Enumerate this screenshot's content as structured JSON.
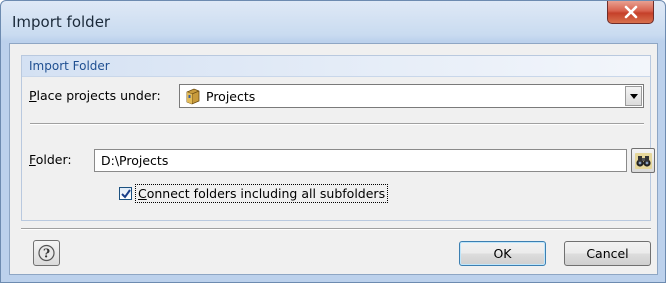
{
  "window": {
    "title": "Import folder"
  },
  "group": {
    "title": "Import Folder"
  },
  "place": {
    "label_prefix": "",
    "label_accel": "P",
    "label_rest": "lace projects under:",
    "selected": "Projects",
    "selected_icon": "projects-folder-icon"
  },
  "folder": {
    "label_accel": "F",
    "label_rest": "older:",
    "value": "D:\\Projects"
  },
  "connect": {
    "checked": true,
    "label_accel": "C",
    "label_rest": "onnect folders including all subfolders"
  },
  "buttons": {
    "ok": "OK",
    "cancel": "Cancel"
  },
  "icons": {
    "close": "close-icon",
    "help": "help-icon",
    "browse": "binoculars-icon"
  }
}
